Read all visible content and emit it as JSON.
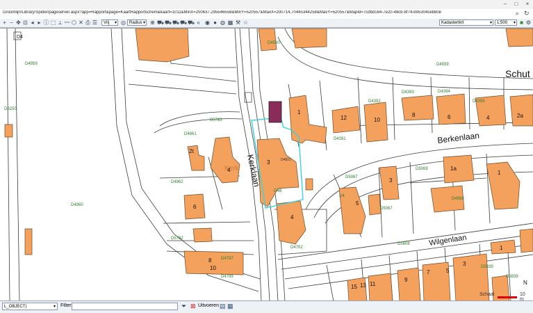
{
  "browser": {
    "url": "Groomlijn/Library/Spider/pageserver.aspx?app=Rapport&page=KaartRapportschem&kaart=1011&MinX=200637.295546558&MinY=520557&MaxX=200714.70445344258&MaxY=520557&MapId=7cdbd164-7e20-48cb-8f74-b95304ceb80e"
  },
  "toolbar": {
    "mode_select": "Vrij",
    "radius_select": "Radius",
    "layer_select": "Kadastertkrt",
    "scale_select": "1:500"
  },
  "map": {
    "street_labels": [
      "Schut",
      "Berkenlaan",
      "Kerklaan",
      "Wilgenlaan"
    ],
    "parcel_labels": [
      "D4959",
      "D4939",
      "D4560",
      "D4393",
      "D4394",
      "D4392",
      "D4395",
      "D6250",
      "D4391",
      "D4861",
      "D5783",
      "D4962",
      "D5069",
      "D4960",
      "D5067",
      "D4702",
      "D5782",
      "D4797",
      "D4799",
      "D5608",
      "D5839",
      "D5839",
      "D4958",
      "D5987",
      "D4"
    ],
    "house_numbers": [
      "1",
      "12",
      "10",
      "8",
      "6",
      "4",
      "2a",
      "3",
      "2t",
      "4",
      "6",
      "1a",
      "1",
      "3",
      "5",
      "4",
      "10",
      "8",
      "1",
      "3",
      "5",
      "7",
      "9",
      "11",
      "13",
      "15"
    ],
    "misc_labels": [
      "Kerk",
      "D4821",
      "D4B",
      "D4"
    ],
    "north_label": "N"
  },
  "status": {
    "object_select": "L_OBJECT)",
    "filter_label": "Filter",
    "filter_value": "",
    "execute_label": "Uitvoeren",
    "scale_label": "Schaal",
    "scale_value": "10 m"
  },
  "colors": {
    "building": "#f4a15d",
    "building_outline": "#6b4a2a",
    "parcel_line": "#3a3a3a",
    "parcel_label": "#2e7d2e",
    "selection": "#39d3e0",
    "marker": "#8b2b5a"
  }
}
